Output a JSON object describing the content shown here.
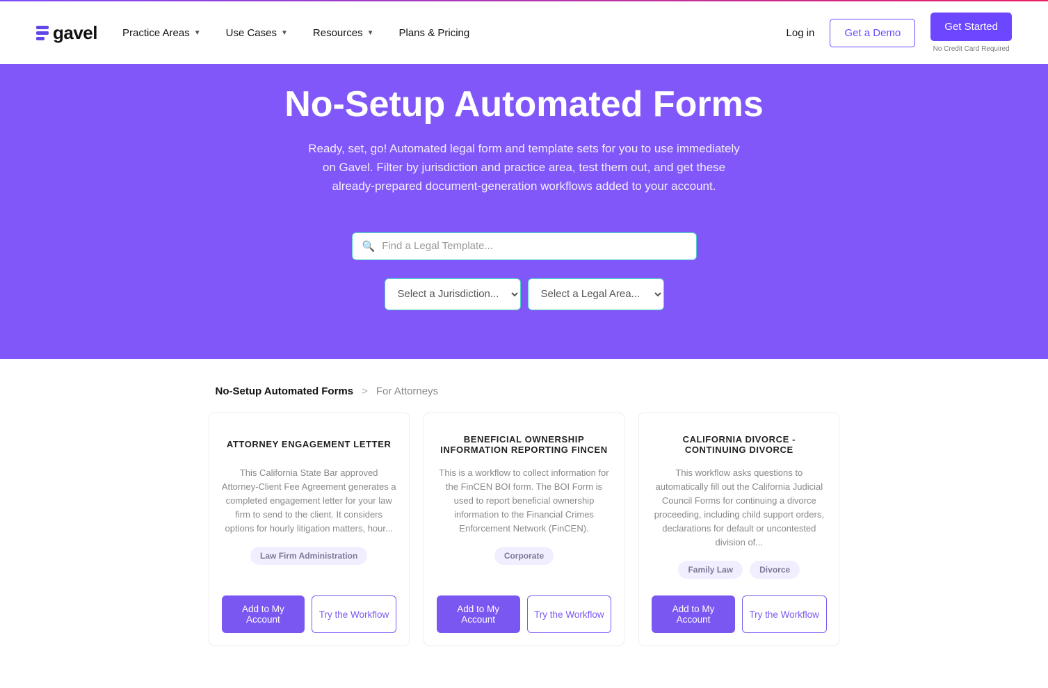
{
  "brand": {
    "name": "gavel"
  },
  "nav": {
    "items": [
      {
        "label": "Practice Areas",
        "dropdown": true
      },
      {
        "label": "Use Cases",
        "dropdown": true
      },
      {
        "label": "Resources",
        "dropdown": true
      },
      {
        "label": "Plans & Pricing",
        "dropdown": false
      }
    ],
    "login": "Log in",
    "demo": "Get a Demo",
    "get_started": "Get Started",
    "no_credit": "No Credit Card Required"
  },
  "hero": {
    "title": "No-Setup Automated Forms",
    "subtitle": "Ready, set, go! Automated legal form and template sets for you to use immediately on Gavel. Filter by jurisdiction and practice area, test them out, and get these already-prepared document-generation workflows added to your account.",
    "search_placeholder": "Find a Legal Template...",
    "jurisdiction_placeholder": "Select a Jurisdiction...",
    "legal_area_placeholder": "Select a Legal Area..."
  },
  "breadcrumb": {
    "root": "No-Setup Automated Forms",
    "sep": ">",
    "current": "For Attorneys"
  },
  "actions": {
    "add": "Add to My Account",
    "try": "Try the Workflow"
  },
  "cards": [
    {
      "title": "ATTORNEY ENGAGEMENT LETTER",
      "desc": "This California State Bar approved Attorney-Client Fee Agreement generates a completed engagement letter for your law firm to send to the client. It considers options for hourly litigation matters, hour...",
      "tags": [
        "Law Firm Administration"
      ]
    },
    {
      "title": "BENEFICIAL OWNERSHIP INFORMATION REPORTING FINCEN",
      "desc": "This is a workflow to collect information for the FinCEN BOI form. The BOI Form is used to report beneficial ownership information to the Financial Crimes Enforcement Network (FinCEN).",
      "tags": [
        "Corporate"
      ]
    },
    {
      "title": "CALIFORNIA DIVORCE - CONTINUING DIVORCE",
      "desc": "This workflow asks questions to automatically fill out the California Judicial Council Forms for continuing a divorce proceeding, including child support orders, declarations for default or uncontested division of...",
      "tags": [
        "Family Law",
        "Divorce"
      ]
    }
  ]
}
